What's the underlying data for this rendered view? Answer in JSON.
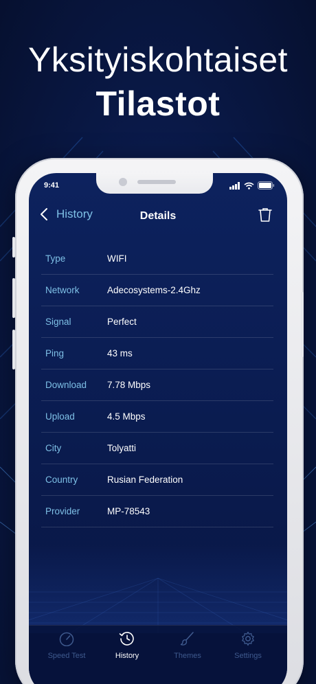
{
  "promo": {
    "line1": "Yksityiskohtaiset",
    "line2": "Tilastot"
  },
  "status_bar": {
    "time": "9:41",
    "icons": [
      "cellular-signal-icon",
      "wifi-icon",
      "battery-icon"
    ]
  },
  "nav": {
    "back_label": "History",
    "title": "Details",
    "trash_icon": "trash-icon"
  },
  "details": [
    {
      "label": "Type",
      "value": "WIFI"
    },
    {
      "label": "Network",
      "value": "Adecosystems-2.4Ghz"
    },
    {
      "label": "Signal",
      "value": "Perfect"
    },
    {
      "label": "Ping",
      "value": "43 ms"
    },
    {
      "label": "Download",
      "value": "7.78 Mbps"
    },
    {
      "label": "Upload",
      "value": "4.5 Mbps"
    },
    {
      "label": "City",
      "value": "Tolyatti"
    },
    {
      "label": "Country",
      "value": "Rusian Federation"
    },
    {
      "label": "Provider",
      "value": "MP-78543"
    }
  ],
  "tabs": [
    {
      "label": "Speed Test",
      "icon": "speedometer-icon",
      "active": false
    },
    {
      "label": "History",
      "icon": "history-icon",
      "active": true
    },
    {
      "label": "Themes",
      "icon": "brush-icon",
      "active": false
    },
    {
      "label": "Settings",
      "icon": "gear-icon",
      "active": false
    }
  ],
  "colors": {
    "background": "#0a1a4a",
    "accent_label": "#7ec0e6",
    "value_text": "#ffffff",
    "tab_inactive": "#3f5a8e",
    "tab_active": "#ffffff"
  }
}
